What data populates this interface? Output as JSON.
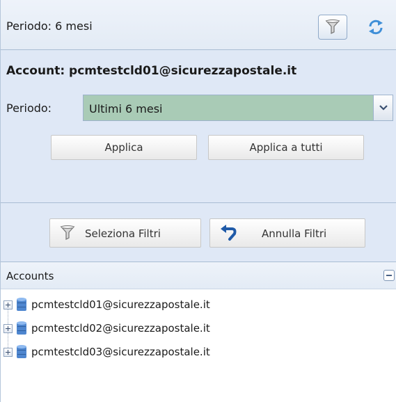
{
  "header": {
    "title": "Periodo: 6 mesi"
  },
  "filter": {
    "account_title": "Account: pcmtestcld01@sicurezzapostale.it",
    "periodo_label": "Periodo:",
    "periodo_value": "Ultimi 6 mesi",
    "apply_label": "Applica",
    "apply_all_label": "Applica a tutti"
  },
  "actions": {
    "select_filters_label": "Seleziona Filtri",
    "clear_filters_label": "Annulla Filtri"
  },
  "accounts": {
    "title": "Accounts",
    "items": [
      {
        "label": "pcmtestcld01@sicurezzapostale.it"
      },
      {
        "label": "pcmtestcld02@sicurezzapostale.it"
      },
      {
        "label": "pcmtestcld03@sicurezzapostale.it"
      }
    ]
  },
  "icons": {
    "filter": "funnel-icon",
    "refresh": "refresh-icon",
    "dropdown": "chevron-down-icon",
    "undo": "undo-arrow-icon",
    "expand": "plus-box-icon",
    "database": "database-icon",
    "collapse": "minus-icon"
  },
  "colors": {
    "panel_bg": "#dfe8f6",
    "select_bg": "#a9cbb6",
    "undo_blue": "#1f5aa8"
  }
}
